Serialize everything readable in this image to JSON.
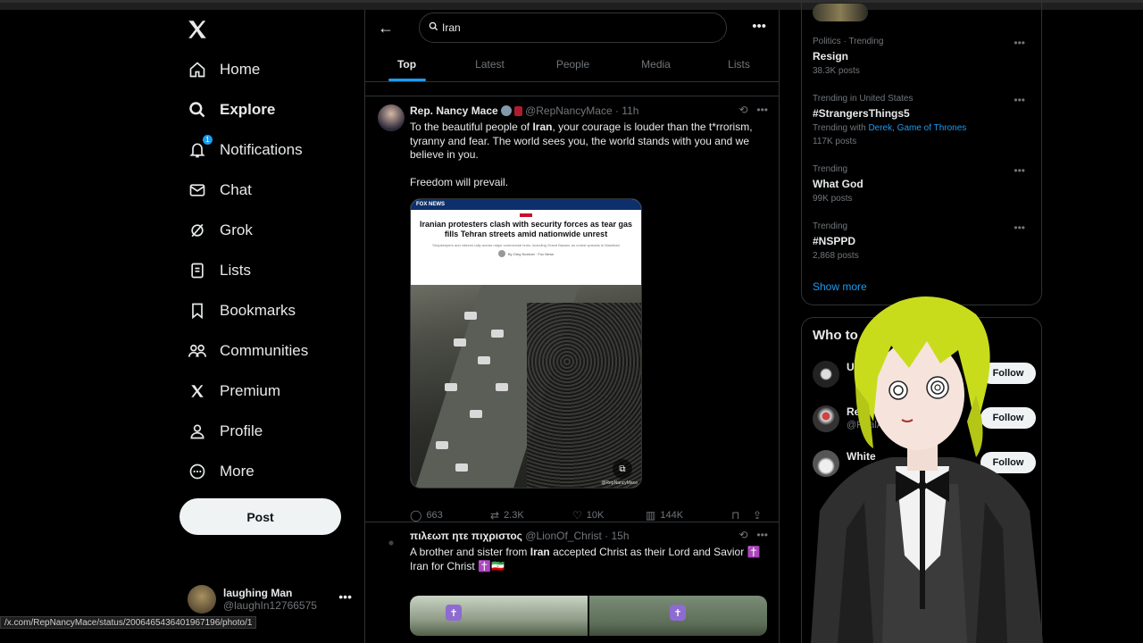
{
  "nav": {
    "items": [
      {
        "label": "Home",
        "icon": "home-icon"
      },
      {
        "label": "Explore",
        "icon": "search-icon"
      },
      {
        "label": "Notifications",
        "icon": "bell-icon",
        "badge": "1"
      },
      {
        "label": "Chat",
        "icon": "mail-icon"
      },
      {
        "label": "Grok",
        "icon": "grok-icon"
      },
      {
        "label": "Lists",
        "icon": "list-icon"
      },
      {
        "label": "Bookmarks",
        "icon": "bookmark-icon"
      },
      {
        "label": "Communities",
        "icon": "people-icon"
      },
      {
        "label": "Premium",
        "icon": "x-logo-icon"
      },
      {
        "label": "Profile",
        "icon": "person-icon"
      },
      {
        "label": "More",
        "icon": "more-circle-icon"
      }
    ],
    "active": "Explore",
    "post_label": "Post"
  },
  "account": {
    "name": "laughing Man",
    "handle": "@laughIn12766575"
  },
  "status_url": "/x.com/RepNancyMace/status/2006465436401967196/photo/1",
  "search": {
    "query": "Iran"
  },
  "tabs": [
    "Top",
    "Latest",
    "People",
    "Media",
    "Lists"
  ],
  "active_tab": "Top",
  "tweets": [
    {
      "display_name": "Rep. Nancy Mace",
      "handle": "@RepNancyMace",
      "time": "11h",
      "text_parts": [
        "To the beautiful people of ",
        "Iran",
        ", your courage is louder than the t*rrorism, tyranny and fear. The world sees you, the world stands with you and we believe in you."
      ],
      "text2": "Freedom will prevail.",
      "media": {
        "source": "FOX NEWS",
        "headline": "Iranian protesters clash with security forces as tear gas fills Tehran streets amid nationwide unrest",
        "subhead": "Shopkeepers and citizens rally across major commercial hubs, including Grand Bazaar, as unrest spreads to Mashhad",
        "byline": "By Greg Norman · Fox News",
        "watermark": "@RepNancyMace"
      },
      "replies": "663",
      "reposts": "2.3K",
      "likes": "10K",
      "views": "144K"
    },
    {
      "display_name": "πιλεωπ ητε πιχριστος",
      "handle": "@LionOf_Christ",
      "time": "15h",
      "text_parts": [
        "A brother and sister from ",
        "Iran",
        " accepted Christ as their Lord and Savior ✝️"
      ],
      "text2": "Iran for Christ ✝️🇮🇷"
    }
  ],
  "trends": [
    {
      "context": "Politics · Trending",
      "name": "Resign",
      "count": "38.3K posts"
    },
    {
      "context": "Trending in United States",
      "name": "#StrangersThings5",
      "with_prefix": "Trending with ",
      "with_links": "Derek, Game of Thrones",
      "count": "117K posts"
    },
    {
      "context": "Trending",
      "name": "What God",
      "count": "99K posts"
    },
    {
      "context": "Trending",
      "name": "#NSPPD",
      "count": "2,868 posts"
    }
  ],
  "show_more": "Show more",
  "who_to_follow": {
    "title": "Who to",
    "users": [
      {
        "name": "U",
        "handle": ""
      },
      {
        "name": "Rea",
        "handle": "@RealA"
      },
      {
        "name": "White",
        "handle": ""
      }
    ],
    "follow_label": "Follow"
  },
  "colors": {
    "accent": "#1d9bf0",
    "bg": "#000000",
    "border": "#2f3336",
    "muted": "#71767b"
  }
}
